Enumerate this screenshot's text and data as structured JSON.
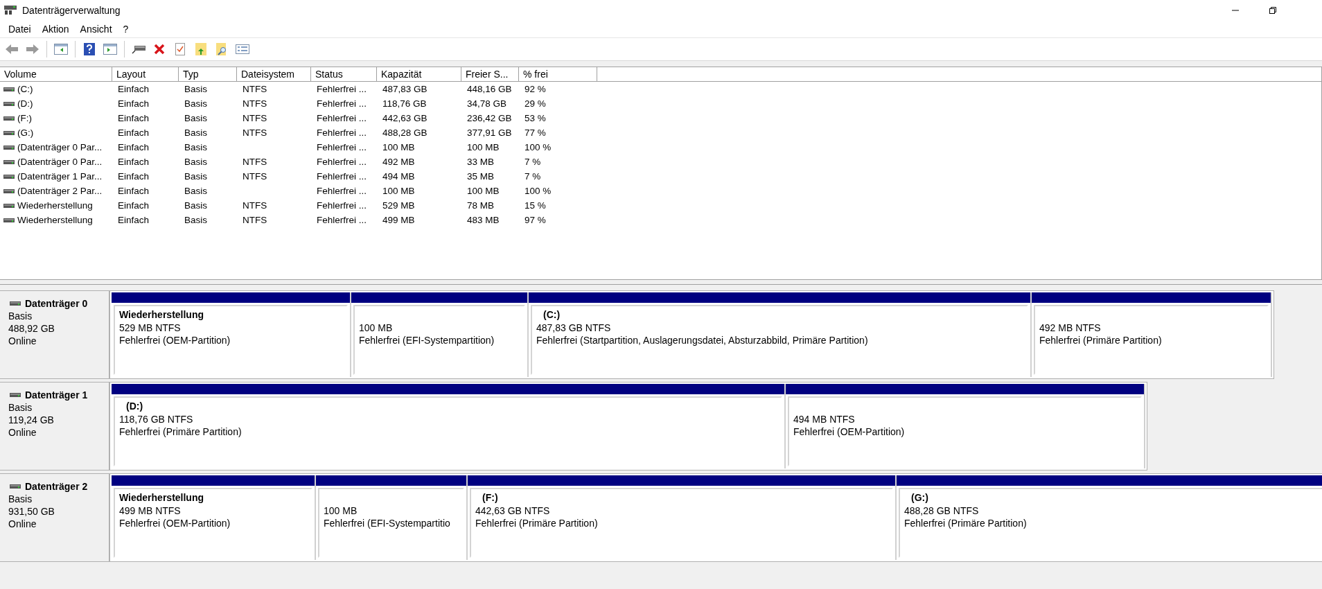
{
  "window": {
    "title": "Datenträgerverwaltung"
  },
  "menu": [
    "Datei",
    "Aktion",
    "Ansicht",
    "?"
  ],
  "toolbar": [
    {
      "kind": "back"
    },
    {
      "kind": "forward"
    },
    {
      "kind": "sep"
    },
    {
      "kind": "tree"
    },
    {
      "kind": "sep"
    },
    {
      "kind": "help"
    },
    {
      "kind": "pane"
    },
    {
      "kind": "sep"
    },
    {
      "kind": "connect"
    },
    {
      "kind": "delete"
    },
    {
      "kind": "check"
    },
    {
      "kind": "folderup"
    },
    {
      "kind": "foldersearch"
    },
    {
      "kind": "props"
    }
  ],
  "table": {
    "columns": [
      "Volume",
      "Layout",
      "Typ",
      "Dateisystem",
      "Status",
      "Kapazität",
      "Freier S...",
      "% frei"
    ],
    "rows": [
      {
        "volume": "(C:)",
        "layout": "Einfach",
        "type": "Basis",
        "filesystem": "NTFS",
        "status": "Fehlerfrei ...",
        "capacity": "487,83 GB",
        "free": "448,16 GB",
        "percent": "92 %"
      },
      {
        "volume": "(D:)",
        "layout": "Einfach",
        "type": "Basis",
        "filesystem": "NTFS",
        "status": "Fehlerfrei ...",
        "capacity": "118,76 GB",
        "free": "34,78 GB",
        "percent": "29 %"
      },
      {
        "volume": "(F:)",
        "layout": "Einfach",
        "type": "Basis",
        "filesystem": "NTFS",
        "status": "Fehlerfrei ...",
        "capacity": "442,63 GB",
        "free": "236,42 GB",
        "percent": "53 %"
      },
      {
        "volume": "(G:)",
        "layout": "Einfach",
        "type": "Basis",
        "filesystem": "NTFS",
        "status": "Fehlerfrei ...",
        "capacity": "488,28 GB",
        "free": "377,91 GB",
        "percent": "77 %"
      },
      {
        "volume": "(Datenträger 0 Par...",
        "layout": "Einfach",
        "type": "Basis",
        "status": "Fehlerfrei ...",
        "capacity": "100 MB",
        "free": "100 MB",
        "percent": "100 %"
      },
      {
        "volume": "(Datenträger 0 Par...",
        "layout": "Einfach",
        "type": "Basis",
        "filesystem": "NTFS",
        "status": "Fehlerfrei ...",
        "capacity": "492 MB",
        "free": "33 MB",
        "percent": "7 %"
      },
      {
        "volume": "(Datenträger 1 Par...",
        "layout": "Einfach",
        "type": "Basis",
        "filesystem": "NTFS",
        "status": "Fehlerfrei ...",
        "capacity": "494 MB",
        "free": "35 MB",
        "percent": "7 %"
      },
      {
        "volume": "(Datenträger 2 Par...",
        "layout": "Einfach",
        "type": "Basis",
        "status": "Fehlerfrei ...",
        "capacity": "100 MB",
        "free": "100 MB",
        "percent": "100 %"
      },
      {
        "volume": "Wiederherstellung",
        "layout": "Einfach",
        "type": "Basis",
        "filesystem": "NTFS",
        "status": "Fehlerfrei ...",
        "capacity": "529 MB",
        "free": "78 MB",
        "percent": "15 %"
      },
      {
        "volume": "Wiederherstellung",
        "layout": "Einfach",
        "type": "Basis",
        "filesystem": "NTFS",
        "status": "Fehlerfrei ...",
        "capacity": "499 MB",
        "free": "483 MB",
        "percent": "97 %"
      }
    ]
  },
  "disks": [
    {
      "name": "Datenträger 0",
      "type": "Basis",
      "size": "488,92 GB",
      "state": "Online",
      "partitions": [
        {
          "kind": "named",
          "title": "Wiederherstellung",
          "size": "529 MB NTFS",
          "status": "Fehlerfrei (OEM-Partition)"
        },
        {
          "kind": "plain",
          "size": "100 MB",
          "status": "Fehlerfrei (EFI-Systempartition)"
        },
        {
          "kind": "drive",
          "title": "(C:)",
          "size": "487,83 GB NTFS",
          "status": "Fehlerfrei (Startpartition, Auslagerungsdatei, Absturzabbild, Primäre Partition)"
        },
        {
          "kind": "plain",
          "size": "492 MB NTFS",
          "status": "Fehlerfrei (Primäre Partition)"
        }
      ]
    },
    {
      "name": "Datenträger 1",
      "type": "Basis",
      "size": "119,24 GB",
      "state": "Online",
      "partitions": [
        {
          "kind": "drive",
          "title": "(D:)",
          "size": "118,76 GB NTFS",
          "status": "Fehlerfrei (Primäre Partition)"
        },
        {
          "kind": "plain",
          "size": "494 MB NTFS",
          "status": "Fehlerfrei (OEM-Partition)"
        }
      ]
    },
    {
      "name": "Datenträger 2",
      "type": "Basis",
      "size": "931,50 GB",
      "state": "Online",
      "partitions": [
        {
          "kind": "named",
          "title": "Wiederherstellung",
          "size": "499 MB NTFS",
          "status": "Fehlerfrei (OEM-Partition)"
        },
        {
          "kind": "plain",
          "size": "100 MB",
          "status": "Fehlerfrei (EFI-Systempartitio"
        },
        {
          "kind": "drive",
          "title": "(F:)",
          "size": "442,63 GB NTFS",
          "status": "Fehlerfrei (Primäre Partition)"
        },
        {
          "kind": "drive",
          "title": "(G:)",
          "size": "488,28 GB NTFS",
          "status": "Fehlerfrei (Primäre Partition)"
        }
      ]
    }
  ]
}
